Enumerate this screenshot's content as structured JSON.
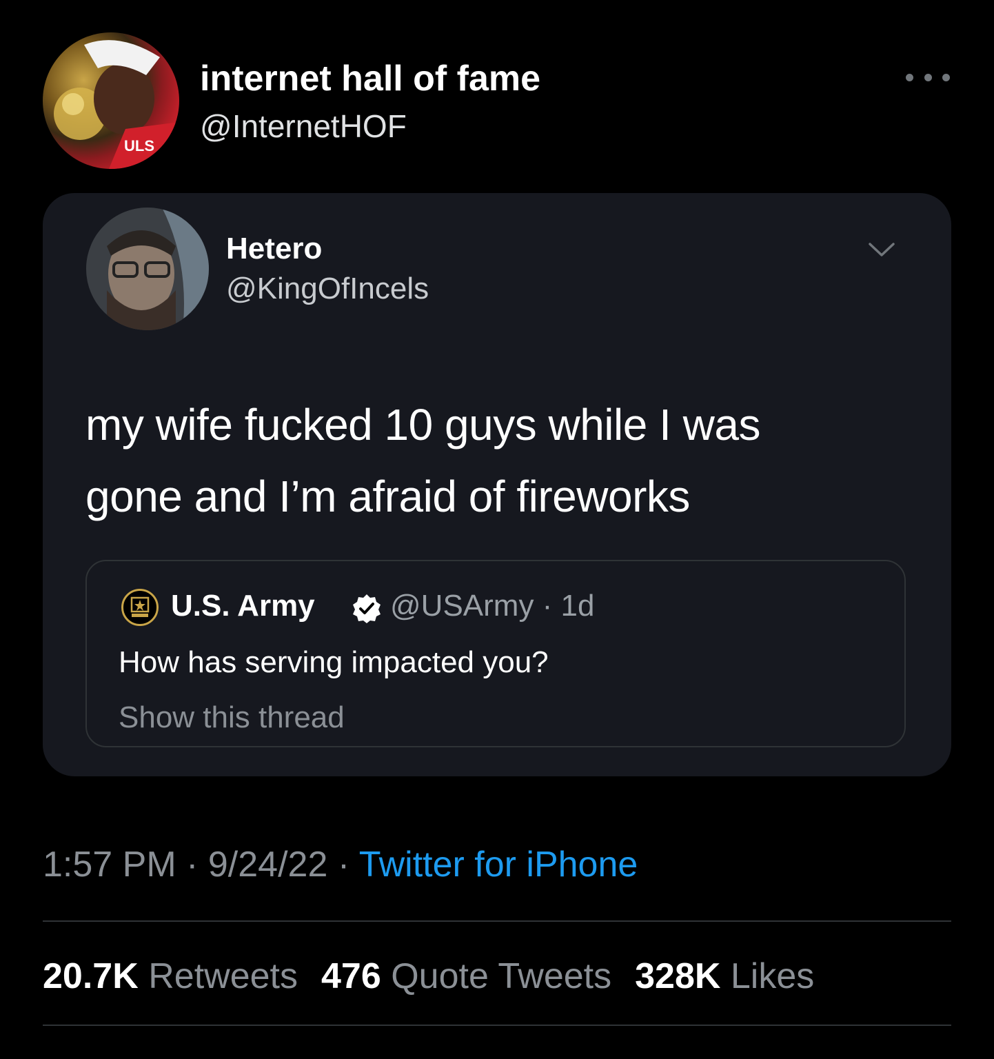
{
  "tweet": {
    "author": {
      "display_name": "internet hall of fame",
      "handle": "@InternetHOF"
    },
    "more_icon": "more-horizontal-icon"
  },
  "card": {
    "author": {
      "display_name": "Hetero",
      "handle": "@KingOfIncels"
    },
    "menu_icon": "chevron-down-icon",
    "text_line1": "my wife fucked 10 guys while I was",
    "text_line2": "gone and I’m afraid of fireworks",
    "quoted": {
      "display_name": "U.S. Army",
      "verified_icon": "verified-badge-icon",
      "handle_time": "@USArmy · 1d",
      "text": "How has serving impacted you?",
      "show_thread": "Show this thread"
    }
  },
  "meta": {
    "time": "1:57 PM",
    "date": "9/24/22",
    "separator": "·",
    "source": "Twitter for iPhone"
  },
  "stats": {
    "retweets_count": "20.7K",
    "retweets_label": "Retweets",
    "quotes_count": "476",
    "quotes_label": "Quote Tweets",
    "likes_count": "328K",
    "likes_label": "Likes"
  },
  "colors": {
    "background": "#000000",
    "card": "#16181f",
    "link": "#1d9bf0",
    "secondary_text": "#8b9096",
    "verified": "#ffffff"
  }
}
